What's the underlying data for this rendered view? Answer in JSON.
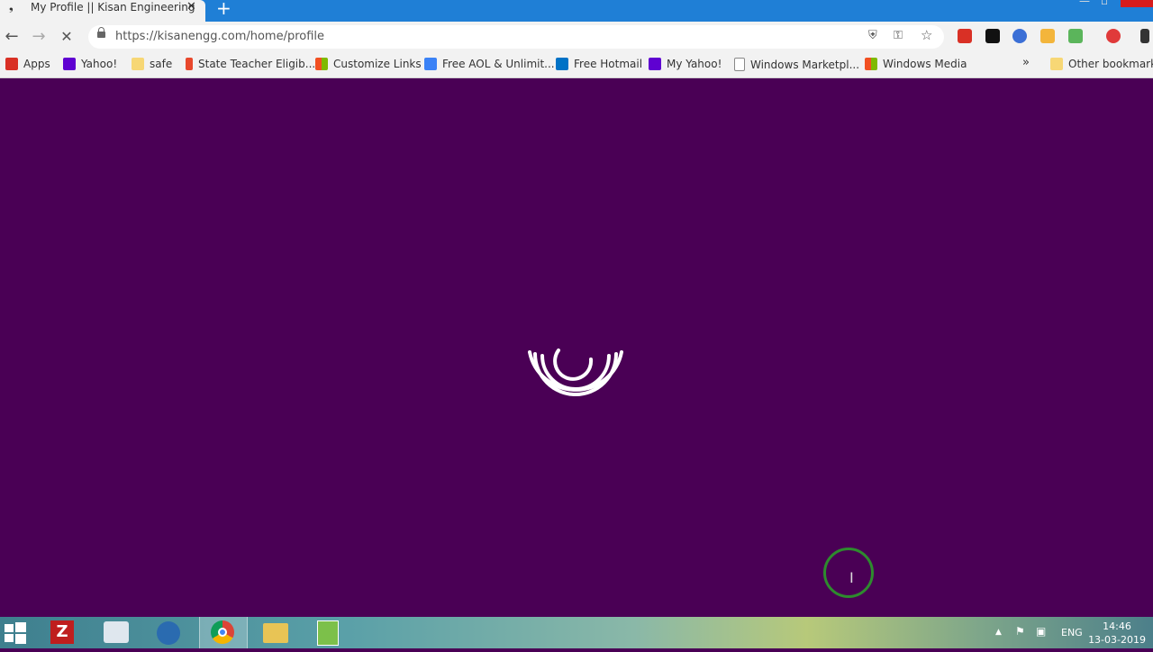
{
  "browser": {
    "tab_title": "My Profile || Kisan Engineering",
    "tab_close": "✕",
    "new_tab": "+",
    "url": "https://kisanengg.com/home/profile"
  },
  "bookmarks": [
    {
      "label": "Apps",
      "icon": "apps-icon",
      "color": "#d93025"
    },
    {
      "label": "Yahoo!",
      "icon": "yahoo-icon",
      "color": "#5f01d1"
    },
    {
      "label": "safe",
      "icon": "folder-icon",
      "color": "#f7d775"
    },
    {
      "label": "State Teacher Eligib...",
      "icon": "pin-icon",
      "color": "#e8482c"
    },
    {
      "label": "Customize Links",
      "icon": "windows-icon",
      "color": "#f25022"
    },
    {
      "label": "Free AOL & Unlimit...",
      "icon": "aol-icon",
      "color": "#3b82f6"
    },
    {
      "label": "Free Hotmail",
      "icon": "outlook-icon",
      "color": "#0072c6"
    },
    {
      "label": "My Yahoo!",
      "icon": "yahoo-icon",
      "color": "#5f01d1"
    },
    {
      "label": "Windows Marketpl...",
      "icon": "page-icon",
      "color": "#ffffff"
    },
    {
      "label": "Windows Media",
      "icon": "windows-icon",
      "color": "#f25022"
    }
  ],
  "bookmarks_more": "»",
  "other_bookmarks": "Other bookmarks",
  "tray": {
    "lang": "ENG",
    "time": "14:46",
    "date": "13-03-2019"
  },
  "colors": {
    "page_bg": "#4a0055",
    "tab_strip": "#1f7fd6"
  }
}
